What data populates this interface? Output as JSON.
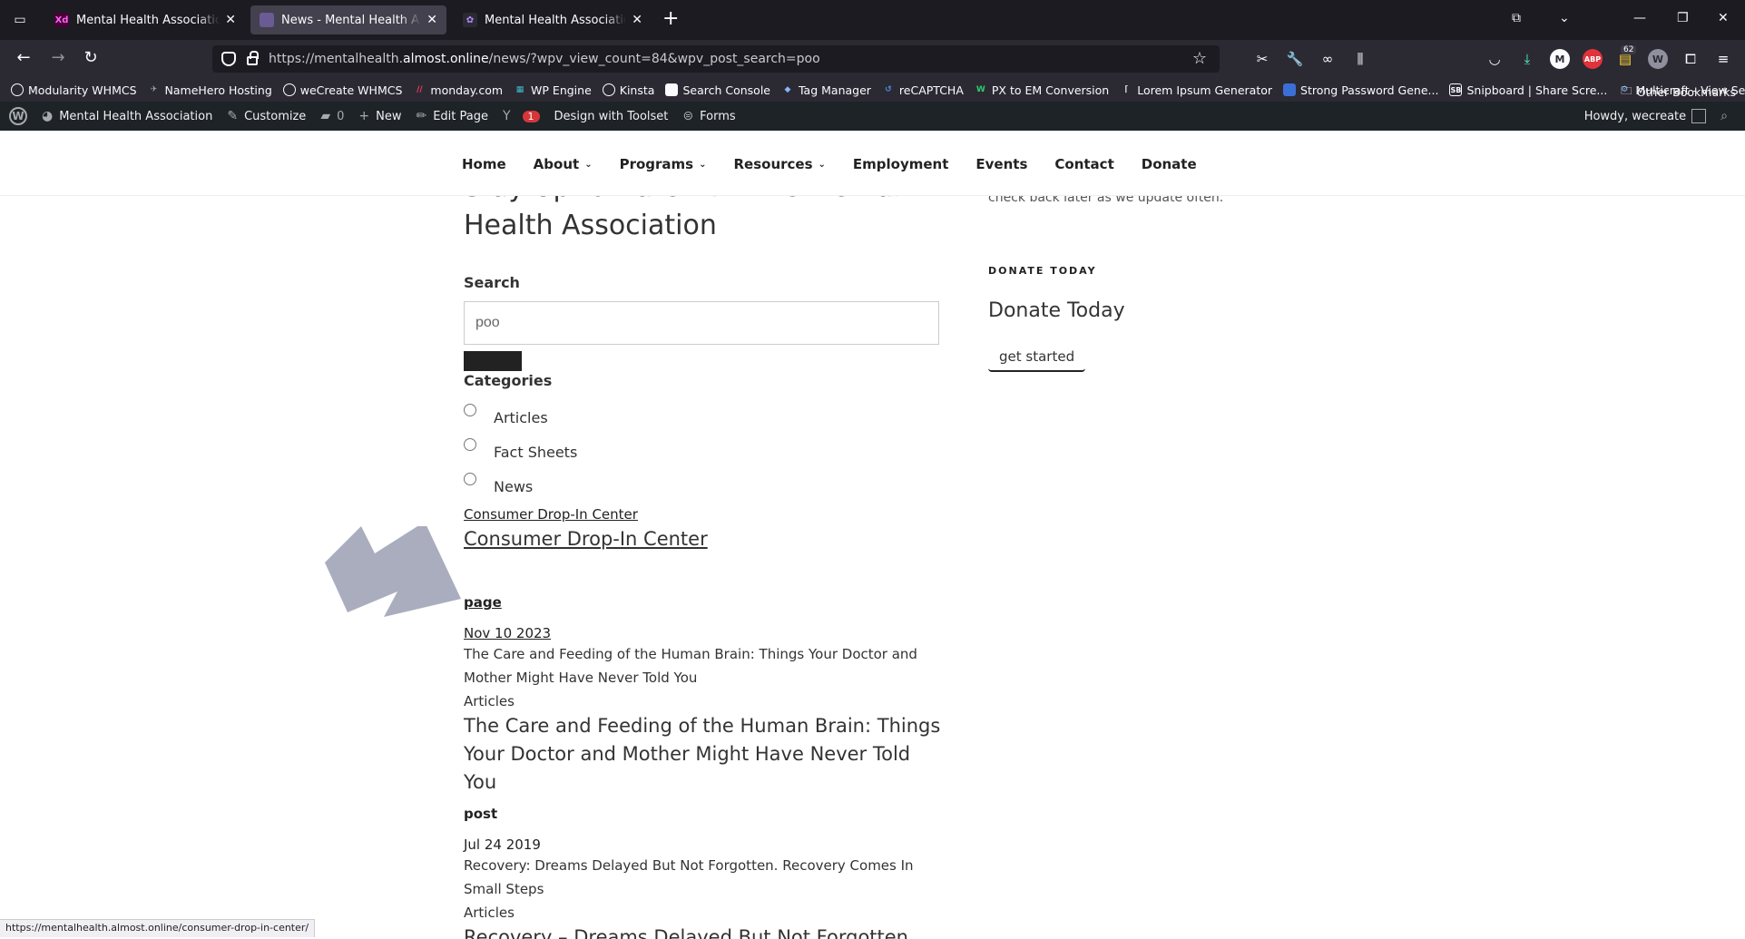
{
  "browser": {
    "tabs": [
      {
        "label": "Mental Health Association – Design",
        "favicon": "Xd",
        "active": false
      },
      {
        "label": "News - Mental Health Association",
        "favicon": "mh",
        "active": true
      },
      {
        "label": "Mental Health Association of Nebraska",
        "favicon": "wp",
        "active": false
      }
    ],
    "url_prefix": "https://mentalhealth.",
    "url_domain": "almost.online",
    "url_path": "/news/?wpv_view_count=84&wpv_post_search=poo",
    "extension_badge": "62",
    "bookmarks": [
      "Modularity WHMCS",
      "NameHero Hosting",
      "weCreate WHMCS",
      "monday.com",
      "WP Engine",
      "Kinsta",
      "Search Console",
      "Tag Manager",
      "reCAPTCHA",
      "PX to EM Conversion",
      "Lorem Ipsum Generator",
      "Strong Password Gene...",
      "Snipboard | Share Scre...",
      "Multicraft - View Server"
    ],
    "other_bookmarks": "Other Bookmarks",
    "status_url": "https://mentalhealth.almost.online/consumer-drop-in-center/"
  },
  "wp_admin_bar": {
    "site_name": "Mental Health Association",
    "customize": "Customize",
    "comments_count": "0",
    "new": "New",
    "edit_page": "Edit Page",
    "seo_count": "1",
    "toolset": "Design with Toolset",
    "forms": "Forms",
    "howdy": "Howdy, wecreate"
  },
  "site_menu": [
    {
      "label": "Home",
      "has_children": false
    },
    {
      "label": "About",
      "has_children": true
    },
    {
      "label": "Programs",
      "has_children": true
    },
    {
      "label": "Resources",
      "has_children": true
    },
    {
      "label": "Employment",
      "has_children": false
    },
    {
      "label": "Events",
      "has_children": false
    },
    {
      "label": "Contact",
      "has_children": false
    },
    {
      "label": "Donate",
      "has_children": false
    }
  ],
  "main": {
    "heading": "Stay Up to Date with the Mental Health Association",
    "search_label": "Search",
    "search_value": "poo",
    "categories_label": "Categories",
    "categories": [
      "Articles",
      "Fact Sheets",
      "News"
    ],
    "link_small": "Consumer Drop-In Center",
    "link_big": "Consumer Drop-In Center",
    "sections": [
      {
        "type": "page",
        "date": "Nov 10 2023",
        "excerpt": "The Care and Feeding of the Human Brain: Things Your Doctor and Mother Might Have Never Told You",
        "category": "Articles",
        "title": "The Care and Feeding of the Human Brain: Things Your Doctor and Mother Might Have Never Told You"
      },
      {
        "type": "post",
        "date": "Jul 24 2019",
        "excerpt": "Recovery: Dreams Delayed But Not Forgotten. Recovery Comes In Small Steps",
        "category": "Articles",
        "title": "Recovery – Dreams Delayed But Not Forgotten"
      }
    ]
  },
  "sidebar": {
    "note": "check back later as we update often.",
    "widget_title": "DONATE TODAY",
    "donate_heading": "Donate Today",
    "button": "get started"
  },
  "colors": {
    "chrome_dark": "#1c1b22",
    "chrome_mid": "#2b2a33",
    "wp_bar": "#1d2327",
    "arrow": "#a9adbe"
  }
}
